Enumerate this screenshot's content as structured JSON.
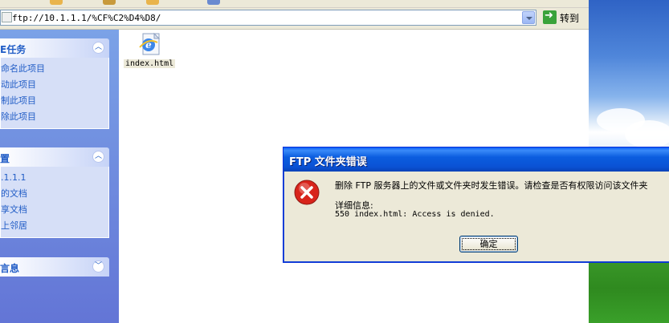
{
  "address_bar": {
    "value": "ftp://10.1.1.1/%CF%C2%D4%D8/",
    "go_label": "转到"
  },
  "task_pane": {
    "panels": [
      {
        "title": "E任务",
        "links": [
          "命名此项目",
          "动此项目",
          "制此项目",
          "除此项目"
        ]
      },
      {
        "title": "置",
        "links": [
          ".1.1.1",
          "的文档",
          "享文档",
          "上邻居"
        ]
      },
      {
        "title": "言息",
        "links": []
      }
    ]
  },
  "files": [
    {
      "name": "index.html",
      "icon": "ie-html-icon"
    }
  ],
  "dialog": {
    "title": "FTP 文件夹错误",
    "message": "删除 FTP 服务器上的文件或文件夹时发生错误。请检查是否有权限访问该文件夹",
    "detail_label": "详细信息:",
    "detail": "550 index.html: Access is denied.",
    "ok_label": "确定",
    "icon": "error-icon"
  },
  "colors": {
    "title_bar": "#0a52d5",
    "task_pane": "#6f8fd9",
    "link": "#215dc6",
    "error": "#d8241b"
  }
}
